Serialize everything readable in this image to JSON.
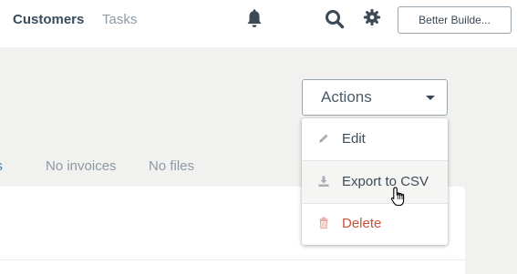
{
  "header": {
    "nav": [
      {
        "label": "Customers"
      },
      {
        "label": "Tasks"
      }
    ],
    "icons": [
      "bell-icon",
      "search-icon",
      "gear-icon"
    ],
    "account_label": "Better Builde..."
  },
  "tabs": [
    {
      "label": "bs"
    },
    {
      "label": "No invoices"
    },
    {
      "label": "No files"
    }
  ],
  "actions": {
    "button_label": "Actions",
    "menu": [
      {
        "label": "Edit",
        "icon": "pencil-icon"
      },
      {
        "label": "Export to CSV",
        "icon": "download-icon"
      },
      {
        "label": "Delete",
        "icon": "trash-icon"
      }
    ]
  },
  "colors": {
    "accent_link": "#3f7fb5",
    "danger": "#c8513a",
    "page_bg": "#f1f1ef"
  }
}
